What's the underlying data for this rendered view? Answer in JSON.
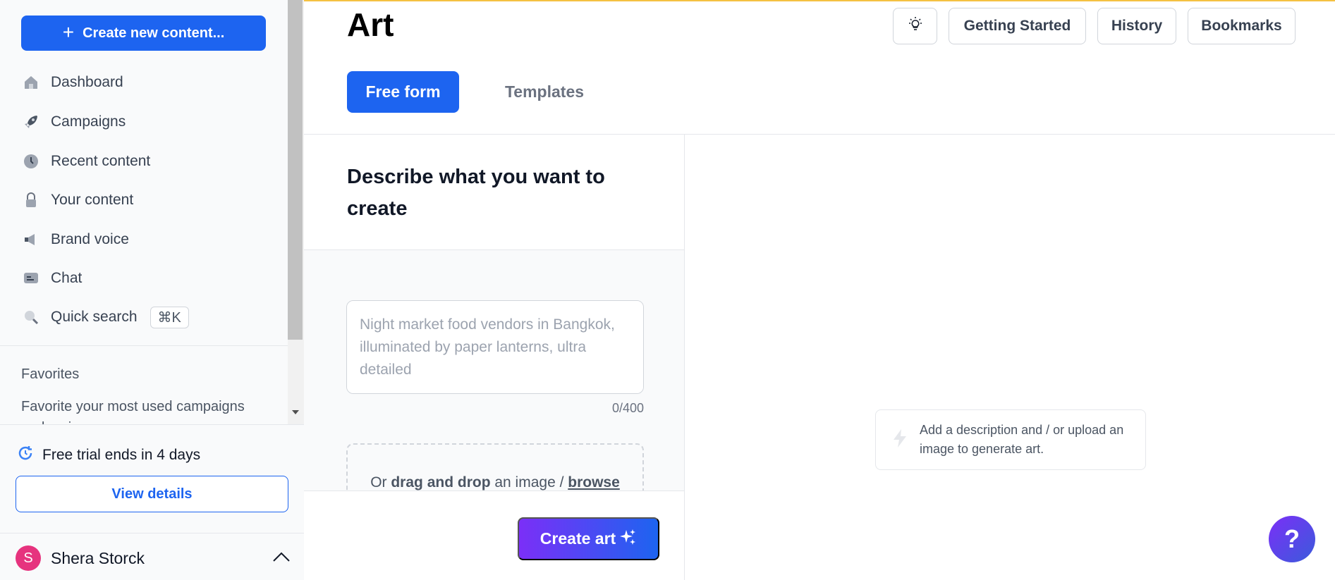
{
  "sidebar": {
    "create_button": {
      "icon": "plus-icon",
      "label": "Create new content..."
    },
    "nav_items": [
      {
        "label": "Dashboard",
        "icon": "home-icon"
      },
      {
        "label": "Campaigns",
        "icon": "rocket-icon"
      },
      {
        "label": "Recent content",
        "icon": "clock-icon"
      },
      {
        "label": "Your content",
        "icon": "lock-icon"
      },
      {
        "label": "Brand voice",
        "icon": "megaphone-icon"
      },
      {
        "label": "Chat",
        "icon": "chat-icon"
      },
      {
        "label": "Quick search",
        "icon": "search-icon",
        "shortcut": "⌘K"
      }
    ],
    "favorites": {
      "title": "Favorites",
      "description": "Favorite your most used campaigns and recipes"
    },
    "trial": {
      "icon": "refresh-clock-icon",
      "text": "Free trial ends in 4 days",
      "button": "View details"
    },
    "user": {
      "initial": "S",
      "name": "Shera Storck",
      "avatar_color": "#e6337e",
      "icon": "chevron-up-icon"
    }
  },
  "header": {
    "title": "Art",
    "buttons": {
      "idea_icon": "lightbulb-icon",
      "getting_started": "Getting Started",
      "history": "History",
      "bookmarks": "Bookmarks"
    },
    "tabs": [
      {
        "label": "Free form",
        "active": true
      },
      {
        "label": "Templates",
        "active": false
      }
    ]
  },
  "form": {
    "heading": "Describe what you want to create",
    "prompt_value": "",
    "prompt_placeholder": "Night market food vendors in Bangkok, illuminated by paper lanterns, ultra detailed",
    "counter": "0/400",
    "drop": {
      "prefix": "Or ",
      "bold": "drag and drop",
      "middle": " an image / ",
      "link": "browse"
    },
    "submit": {
      "label": "Create art",
      "icon": "sparkles-icon"
    }
  },
  "empty_state": {
    "icon": "bolt-icon",
    "text": "Add a description and / or upload an image to generate art."
  },
  "help": {
    "label": "?"
  },
  "colors": {
    "primary": "#1d64f0",
    "gradient_start": "#7b2ff7",
    "top_accent": "#f5c142"
  }
}
